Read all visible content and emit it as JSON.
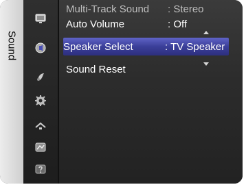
{
  "sidebar": {
    "title": "Sound",
    "icons": [
      {
        "name": "picture-icon"
      },
      {
        "name": "sound-icon"
      },
      {
        "name": "channel-icon"
      },
      {
        "name": "setup-icon"
      },
      {
        "name": "input-icon"
      },
      {
        "name": "application-icon"
      },
      {
        "name": "support-icon"
      }
    ]
  },
  "menu": {
    "rows": [
      {
        "key": "Multi-Track Sound",
        "value": ": Stereo",
        "state": "dimmed"
      },
      {
        "key": "Auto Volume",
        "value": ": Off",
        "state": "normal"
      },
      {
        "key": "Speaker Select",
        "value": ": TV Speaker",
        "state": "selected"
      },
      {
        "key": "Sound Reset",
        "value": "",
        "state": "normal"
      }
    ]
  },
  "colors": {
    "selected_highlight": "#4a4fb6",
    "panel_top": "#3b3b3b",
    "panel_bottom": "#1c1c1c",
    "sidebar_tab": "#e6e6e6"
  }
}
